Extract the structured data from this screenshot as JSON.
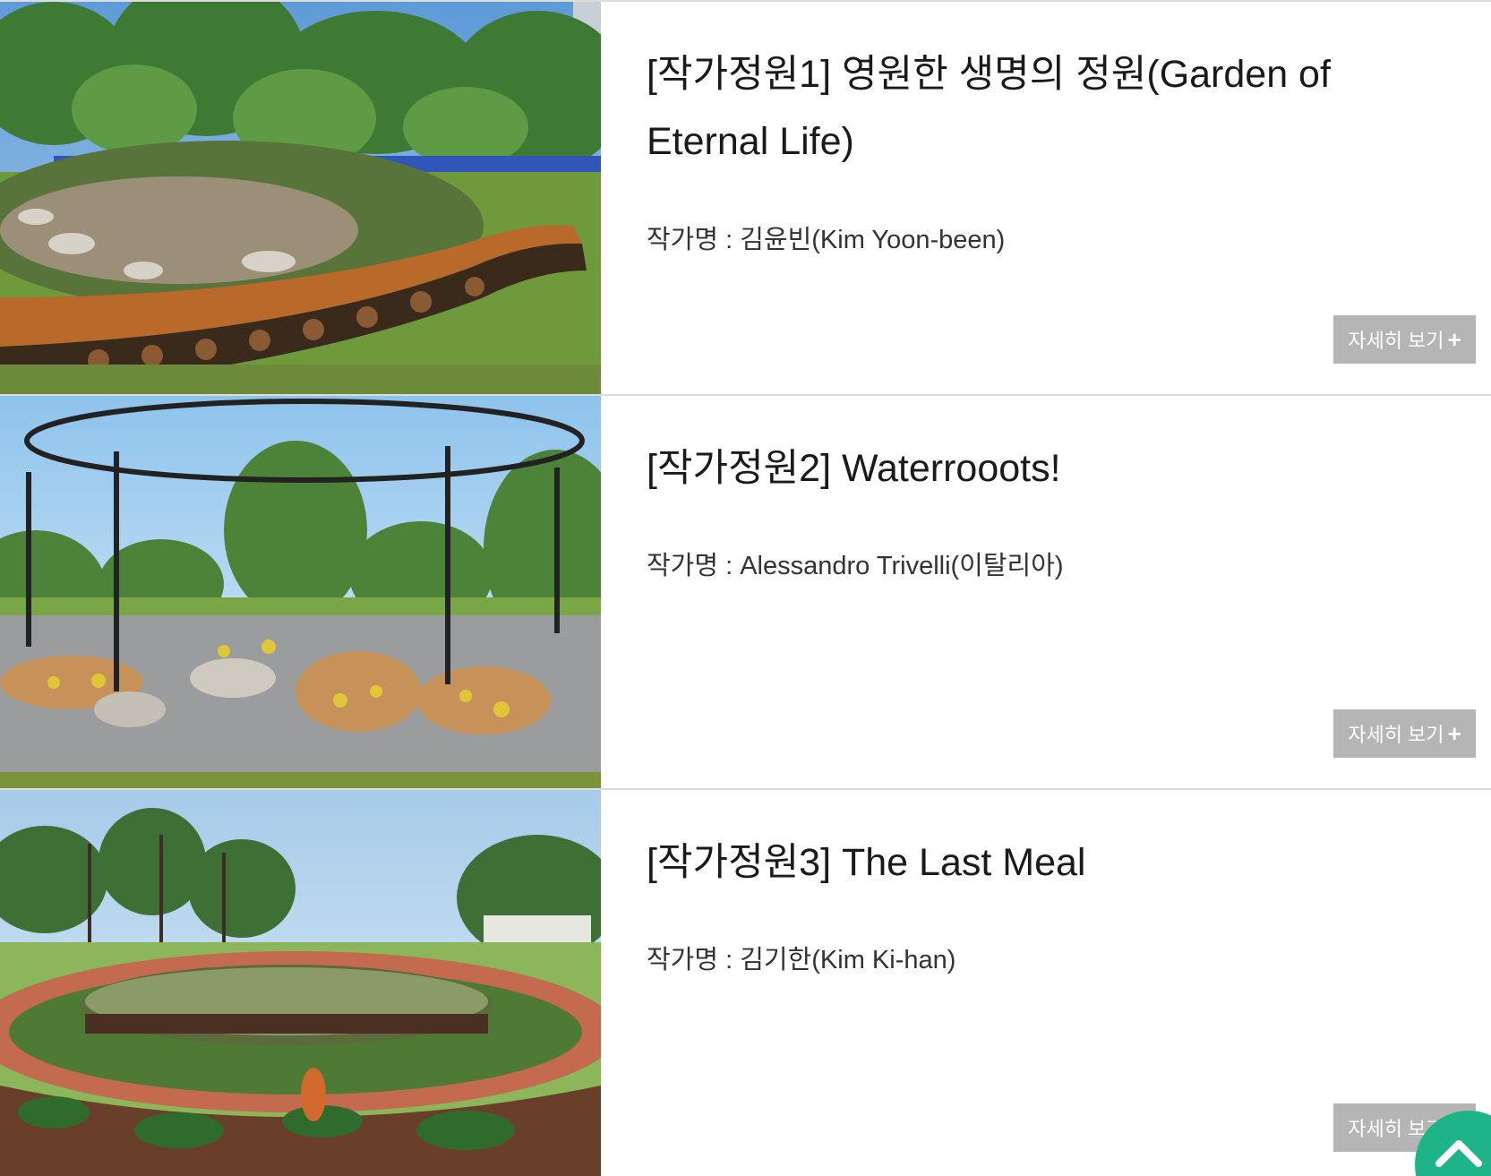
{
  "items": [
    {
      "title": "[작가정원1] 영원한 생명의 정원(Garden of Eternal Life)",
      "author": "작가명 : 김윤빈(Kim Yoon-been)",
      "button": "자세히 보기",
      "image_icon": "garden-photo"
    },
    {
      "title": "[작가정원2] Waterrooots!",
      "author": "작가명 : Alessandro Trivelli(이탈리아)",
      "button": "자세히 보기",
      "image_icon": "garden-photo"
    },
    {
      "title": "[작가정원3] The Last Meal",
      "author": "작가명 : 김기한(Kim Ki-han)",
      "button": "자세히 보기",
      "image_icon": "garden-photo"
    }
  ],
  "plus_symbol": "+",
  "scroll_top_icon": "chevron-up-icon",
  "colors": {
    "button_bg": "#b5b5b5",
    "scroll_top_bg": "#1fb487",
    "divider": "#dcdcdc"
  }
}
